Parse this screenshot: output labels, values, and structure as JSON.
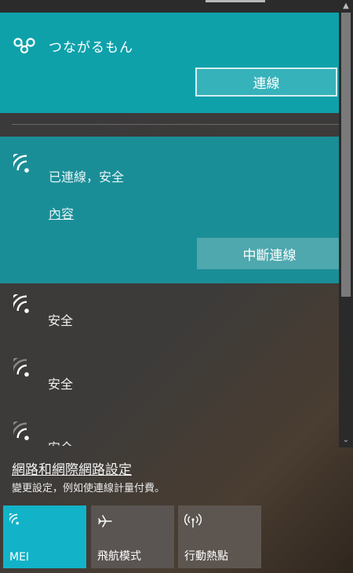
{
  "networks": {
    "hotspot": {
      "name": "つながるもん",
      "connect_label": "連線",
      "icon": "link-icon"
    },
    "connected": {
      "status": "已連線，安全",
      "properties_label": "內容",
      "disconnect_label": "中斷連線",
      "icon": "wifi-icon"
    },
    "others": [
      {
        "status": "安全",
        "icon": "wifi-icon"
      },
      {
        "status": "安全",
        "icon": "wifi-weak-icon"
      },
      {
        "status": "安全",
        "icon": "wifi-weak-icon"
      }
    ]
  },
  "settings": {
    "link": "網路和網際網路設定",
    "description": "變更設定，例如使連線計量付費。"
  },
  "quick_actions": [
    {
      "label": "MEI",
      "icon": "wifi-icon",
      "active": true
    },
    {
      "label": "飛航模式",
      "icon": "airplane-icon",
      "active": false
    },
    {
      "label": "行動熱點",
      "icon": "hotspot-icon",
      "active": false
    }
  ],
  "colors": {
    "accent": "#0ea1aa",
    "connected_bg": "#1a8e97",
    "tile_active": "#12b3c8"
  }
}
